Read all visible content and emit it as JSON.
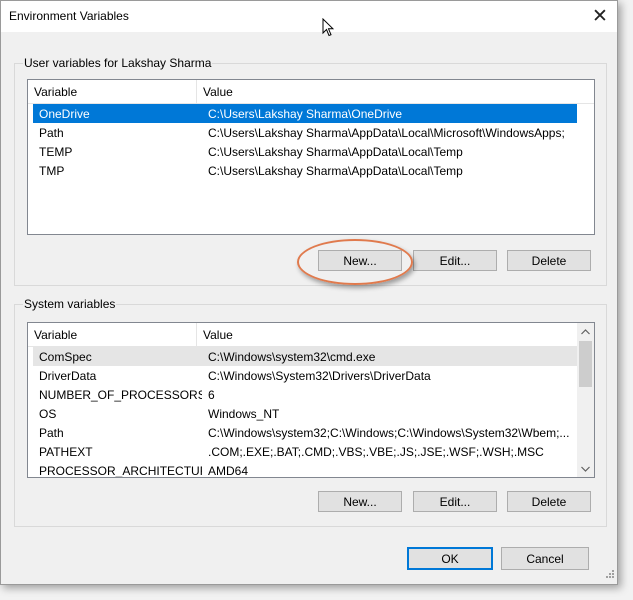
{
  "window": {
    "title": "Environment Variables"
  },
  "user_vars": {
    "group_label": "User variables for Lakshay Sharma",
    "columns": {
      "variable": "Variable",
      "value": "Value"
    },
    "rows": [
      {
        "name": "OneDrive",
        "value": "C:\\Users\\Lakshay Sharma\\OneDrive"
      },
      {
        "name": "Path",
        "value": "C:\\Users\\Lakshay Sharma\\AppData\\Local\\Microsoft\\WindowsApps;"
      },
      {
        "name": "TEMP",
        "value": "C:\\Users\\Lakshay Sharma\\AppData\\Local\\Temp"
      },
      {
        "name": "TMP",
        "value": "C:\\Users\\Lakshay Sharma\\AppData\\Local\\Temp"
      }
    ],
    "buttons": {
      "new": "New...",
      "edit": "Edit...",
      "delete": "Delete"
    }
  },
  "system_vars": {
    "group_label": "System variables",
    "columns": {
      "variable": "Variable",
      "value": "Value"
    },
    "rows": [
      {
        "name": "ComSpec",
        "value": "C:\\Windows\\system32\\cmd.exe"
      },
      {
        "name": "DriverData",
        "value": "C:\\Windows\\System32\\Drivers\\DriverData"
      },
      {
        "name": "NUMBER_OF_PROCESSORS",
        "value": "6"
      },
      {
        "name": "OS",
        "value": "Windows_NT"
      },
      {
        "name": "Path",
        "value": "C:\\Windows\\system32;C:\\Windows;C:\\Windows\\System32\\Wbem;..."
      },
      {
        "name": "PATHEXT",
        "value": ".COM;.EXE;.BAT;.CMD;.VBS;.VBE;.JS;.JSE;.WSF;.WSH;.MSC"
      },
      {
        "name": "PROCESSOR_ARCHITECTURE",
        "value": "AMD64"
      }
    ],
    "buttons": {
      "new": "New...",
      "edit": "Edit...",
      "delete": "Delete"
    }
  },
  "dialog_buttons": {
    "ok": "OK",
    "cancel": "Cancel"
  },
  "icons": {
    "close": "close-icon",
    "cursor": "mouse-cursor-icon",
    "scroll_up": "scroll-up-arrow-icon",
    "scroll_down": "scroll-down-arrow-icon",
    "resize": "resize-grip-icon"
  },
  "colors": {
    "selection": "#0078d7",
    "annotation": "#e07a4d",
    "row_highlight": "#e5e5e5"
  }
}
